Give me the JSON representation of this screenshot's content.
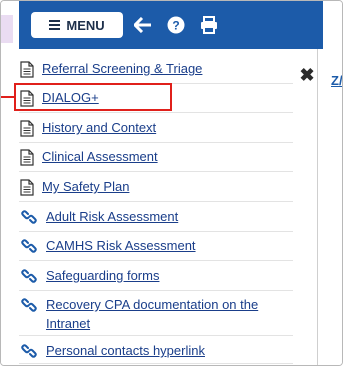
{
  "toolbar": {
    "menu_label": "MENU",
    "icons": [
      "menu-bars-icon",
      "back-arrow-icon",
      "help-icon",
      "print-icon"
    ]
  },
  "right_pane": {
    "label": "Z/"
  },
  "items": [
    {
      "label": "Referral Screening & Triage",
      "icon": "document-icon"
    },
    {
      "label": "DIALOG+",
      "icon": "document-icon"
    },
    {
      "label": "History and Context",
      "icon": "document-icon"
    },
    {
      "label": "Clinical Assessment",
      "icon": "document-icon"
    },
    {
      "label": "My Safety Plan",
      "icon": "document-icon"
    },
    {
      "label": "Adult Risk Assessment",
      "icon": "link-icon"
    },
    {
      "label": "CAMHS Risk Assessment",
      "icon": "link-icon"
    },
    {
      "label": "Safeguarding forms",
      "icon": "link-icon"
    },
    {
      "label": "Recovery CPA documentation on the Intranet",
      "icon": "link-icon"
    },
    {
      "label": "Personal contacts hyperlink",
      "icon": "link-icon"
    }
  ],
  "colors": {
    "toolbar_bg": "#1c5ba9",
    "link": "#1a3e8a",
    "highlight": "#e0201b"
  }
}
